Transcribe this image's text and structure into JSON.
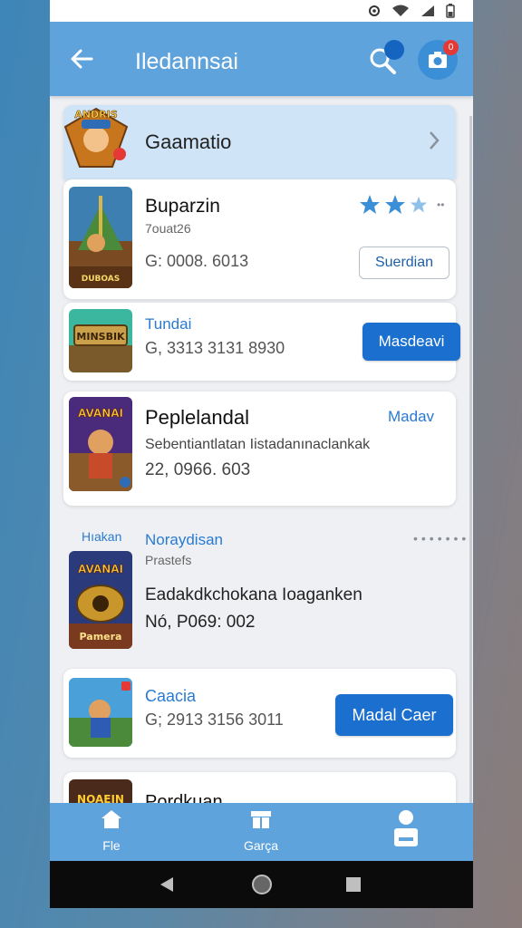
{
  "app_bar": {
    "title": "Iledannsai"
  },
  "notifications": {
    "camera_badge": "0"
  },
  "featured": {
    "label": "Gaamatio"
  },
  "games": [
    {
      "title": "Buparzin",
      "subtitle": "7ouat26",
      "meta": "G: 0008. 6013",
      "button": "Suerdian"
    },
    {
      "title": "Tundai",
      "meta": "G, 3313 3131 8930",
      "button": "Masdeavi"
    },
    {
      "title": "Peplelandal",
      "link": "Madav",
      "description": "Sebentiantlatan Iistadanınaclankak",
      "meta": "22, 0966. 603"
    },
    {
      "category": "Hıakan",
      "title": "Noraydisan",
      "subtitle": "Prastefs",
      "description": "Eadakdkchokana Ioaganken",
      "meta": "Nó, P069: 002"
    },
    {
      "title": "Caacia",
      "meta": "G; 2913 3156 3011",
      "button": "Madal Caer"
    },
    {
      "title": "Pordkuan"
    }
  ],
  "thumb_texts": [
    "DUBOAS",
    "MINSBIK",
    "AVANAI",
    "Pamera",
    "NOAEIN"
  ],
  "bottom_nav": [
    {
      "label": "Fle",
      "icon": "home-icon"
    },
    {
      "label": "Garça",
      "icon": "store-icon"
    },
    {
      "label": "",
      "icon": "profile-icon"
    }
  ],
  "colors": {
    "appbar": "#5fa3dd",
    "accent": "#1a6fcf",
    "star": "#3b8fd6"
  },
  "rating": {
    "stars": 2.5,
    "max": 3
  }
}
